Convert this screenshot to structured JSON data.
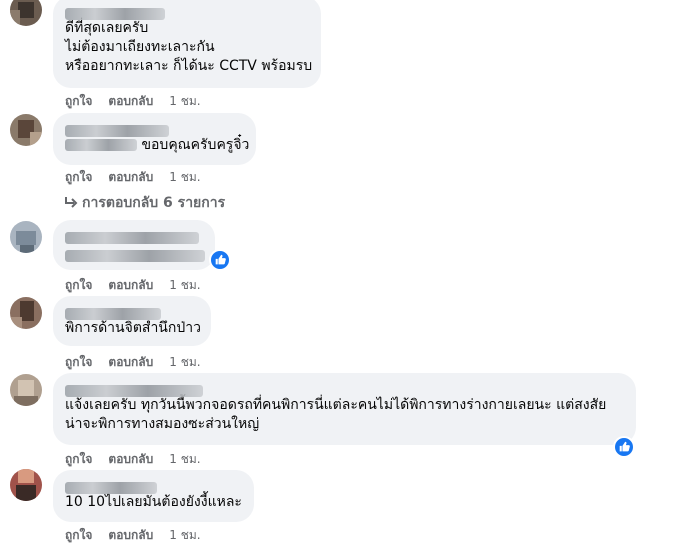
{
  "comments": [
    {
      "lines": [
        "ดีที่สุดเลยครับ",
        "ไม่ต้องมาเถียงทะเลาะกัน",
        "หรืออยากทะเลาะ ก็ได้นะ CCTV พร้อมรบ"
      ],
      "actions": {
        "like": "ถูกใจ",
        "reply": "ตอบกลับ",
        "time": "1 ชม."
      }
    },
    {
      "lines": [
        "ขอบคุณครับครูจิ๋ว"
      ],
      "actions": {
        "like": "ถูกใจ",
        "reply": "ตอบกลับ",
        "time": "1 ชม."
      },
      "replies": "การตอบกลับ 6 รายการ"
    },
    {
      "lines": [],
      "actions": {
        "like": "ถูกใจ",
        "reply": "ตอบกลับ",
        "time": "1 ชม."
      },
      "reaction": "like"
    },
    {
      "lines": [
        "พิการด้านจิตสำนึกป่าว"
      ],
      "actions": {
        "like": "ถูกใจ",
        "reply": "ตอบกลับ",
        "time": "1 ชม."
      }
    },
    {
      "lines": [
        "แจ้งเลยครับ ทุกวันนี้พวกจอดรถที่คนพิการนี่แต่ละคนไม่ได้พิการทางร่างกายเลยนะ แต่สงสัย",
        "น่าจะพิการทางสมองซะส่วนใหญ่"
      ],
      "actions": {
        "like": "ถูกใจ",
        "reply": "ตอบกลับ",
        "time": "1 ชม."
      },
      "reaction": "like"
    },
    {
      "lines": [
        "10 10ไปเลยมันต้องยังงี้แหละ"
      ],
      "actions": {
        "like": "ถูกใจ",
        "reply": "ตอบกลับ",
        "time": "1 ชม."
      }
    }
  ],
  "colors": {
    "bubble": "#f0f2f5",
    "meta": "#65676b",
    "like": "#1877f2"
  },
  "icons": {
    "reply_arrow": "reply-arrow-icon",
    "like_badge": "thumbs-up-icon"
  }
}
